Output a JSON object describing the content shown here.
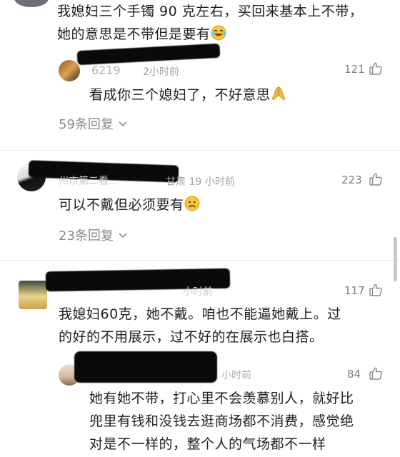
{
  "comment1": {
    "text_line1": "我媳妇三个手镯 90 克左右，买回来基本上不带，",
    "text_line2": "她的意思是不带但是要有",
    "emoji": "laugh-cry",
    "reply": {
      "user_partial": "6219",
      "time_partial": "2小时前",
      "likes": "121",
      "text": "看成你三个媳妇了，不好意思",
      "emoji": "pray"
    },
    "replies_label": "59条回复"
  },
  "comment2": {
    "user_partial": "州市第二看…",
    "location_time": "甘肃 19 小时前",
    "likes": "223",
    "text": "可以不戴但必须要有",
    "emoji": "frown",
    "replies_label": "23条回复"
  },
  "comment3": {
    "time_partial": "小时前",
    "likes": "117",
    "text_line1": "我媳妇60克，她不戴。咱也不能逼她戴上。过",
    "text_line2": "的好的不用展示，过不好的在展示也白搭。",
    "reply": {
      "time_partial": "小时前",
      "likes": "84",
      "text_line1": "她有她不带，打心里不会羡慕别人，就好比",
      "text_line2": "兜里有钱和没钱去逛商场都不消费，感觉绝",
      "text_line3": "对是不一样的，整个人的气场都不一样"
    }
  },
  "colors": {
    "text": "#1e1e1e",
    "meta": "#a3a3a3",
    "redaction": "#0a0a0a"
  }
}
